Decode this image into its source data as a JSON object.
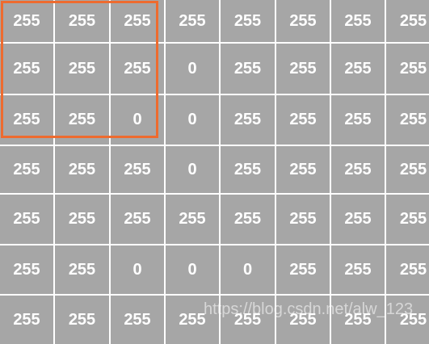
{
  "matrix": [
    [
      "255",
      "255",
      "255",
      "255",
      "255",
      "255",
      "255",
      "255"
    ],
    [
      "255",
      "255",
      "255",
      "0",
      "255",
      "255",
      "255",
      "255"
    ],
    [
      "255",
      "255",
      "0",
      "0",
      "255",
      "255",
      "255",
      "255"
    ],
    [
      "255",
      "255",
      "255",
      "0",
      "255",
      "255",
      "255",
      "255"
    ],
    [
      "255",
      "255",
      "255",
      "255",
      "255",
      "255",
      "255",
      "255"
    ],
    [
      "255",
      "255",
      "0",
      "0",
      "0",
      "255",
      "255",
      "255"
    ],
    [
      "255",
      "255",
      "255",
      "255",
      "255",
      "255",
      "255",
      "255"
    ]
  ],
  "highlight": {
    "rows": 3,
    "cols": 3,
    "color": "#ee6b2f"
  },
  "cell_color": "#a6a6a6",
  "watermark": "https://blog.csdn.net/alw_123"
}
